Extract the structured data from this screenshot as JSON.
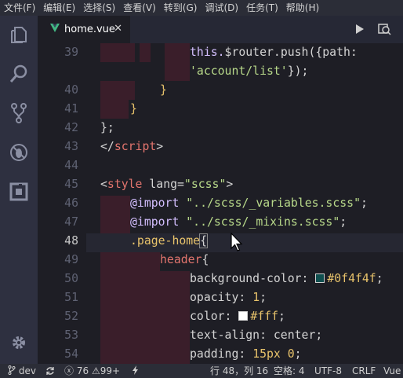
{
  "menu": [
    {
      "label": "文件(F)"
    },
    {
      "label": "编辑(E)"
    },
    {
      "label": "选择(S)"
    },
    {
      "label": "查看(V)"
    },
    {
      "label": "转到(G)"
    },
    {
      "label": "调试(D)"
    },
    {
      "label": "任务(T)"
    },
    {
      "label": "帮助(H)"
    }
  ],
  "activity": {
    "explorer": "files-icon",
    "search": "search-icon",
    "scm": "source-control-icon",
    "debug": "debug-icon",
    "extensions": "extensions-icon",
    "settings": "gear-icon"
  },
  "tab": {
    "filename": "home.vue",
    "icon": "vue-icon",
    "close": "✕"
  },
  "editor_actions": {
    "run": "play-icon",
    "split": "split-view-icon"
  },
  "colors": {
    "background": "#1e1e25",
    "keyword": "#d4bfff",
    "tag": "#e3756e",
    "string": "#b8d98a",
    "number": "#e8c36b",
    "swatch1": "#0f4f4f",
    "swatch2": "#ffffff",
    "vue_green": "#42b883"
  },
  "editor": {
    "line_numbers": [
      "39",
      "",
      "40",
      "41",
      "42",
      "43",
      "44",
      "45",
      "46",
      "47",
      "48",
      "49",
      "50",
      "51",
      "52",
      "53",
      "54"
    ],
    "current_line": "48",
    "lines": {
      "l39_this": "this.",
      "l39_router": "$router",
      "l39_push": ".push({path:",
      "l39b_str": "'account/list'",
      "l39b_end": "});",
      "l40": "}",
      "l41": "}",
      "l42": "};",
      "l43_open": "</",
      "l43_tag": "script",
      "l43_close": ">",
      "l45_open": "<",
      "l45_tag": "style",
      "l45_attr": " lang=",
      "l45_val": "\"scss\"",
      "l45_close": ">",
      "l46_kw": "@import",
      "l46_str": " \"../scss/_variables.scss\"",
      "l46_end": ";",
      "l47_kw": "@import",
      "l47_str": " \"../scss/_mixins.scss\"",
      "l47_end": ";",
      "l48_sel": ".page-home",
      "l48_brace": "{",
      "l49_tag": "header",
      "l49_brace": "{",
      "l50_prop": "background-color: ",
      "l50_val": "#0f4f4f",
      "l50_end": ";",
      "l51_prop": "opacity: ",
      "l51_val": "1",
      "l51_end": ";",
      "l52_prop": "color: ",
      "l52_val": "#fff",
      "l52_end": ";",
      "l53": "text-align: center;",
      "l54_prop": "padding: ",
      "l54_val": "15px 0",
      "l54_end": ";"
    }
  },
  "status": {
    "branch": "dev",
    "errors": "76",
    "warnings": "99+",
    "position": "行 48，列 16",
    "indent": "空格: 4",
    "encoding": "UTF-8",
    "eol": "CRLF",
    "language": "Vue"
  }
}
